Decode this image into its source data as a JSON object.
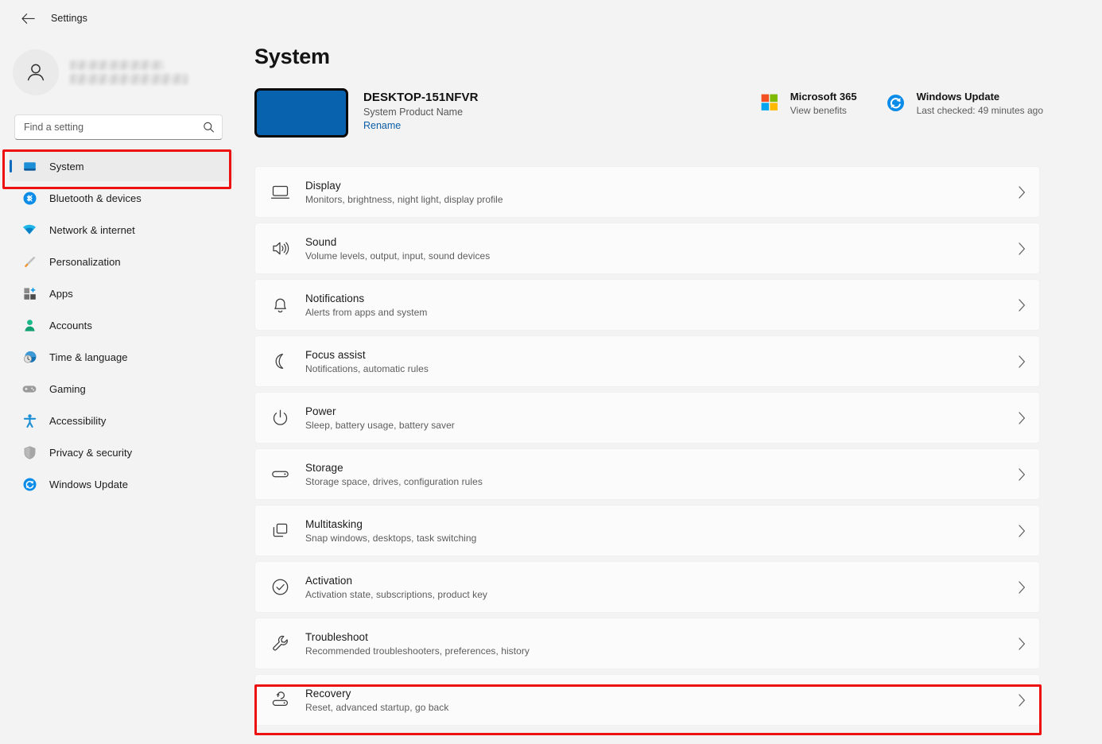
{
  "window": {
    "title": "Settings",
    "back_icon": "back-arrow-icon"
  },
  "sidebar": {
    "profile": {
      "name_redacted": true,
      "avatar_icon": "user-avatar-icon"
    },
    "search": {
      "placeholder": "Find a setting",
      "value": "",
      "icon": "search-icon"
    },
    "items": [
      {
        "label": "System",
        "icon": "system-monitor-icon",
        "selected": true
      },
      {
        "label": "Bluetooth & devices",
        "icon": "bluetooth-icon",
        "selected": false
      },
      {
        "label": "Network & internet",
        "icon": "wifi-icon",
        "selected": false
      },
      {
        "label": "Personalization",
        "icon": "paintbrush-icon",
        "selected": false
      },
      {
        "label": "Apps",
        "icon": "apps-grid-icon",
        "selected": false
      },
      {
        "label": "Accounts",
        "icon": "person-icon",
        "selected": false
      },
      {
        "label": "Time & language",
        "icon": "clock-globe-icon",
        "selected": false
      },
      {
        "label": "Gaming",
        "icon": "gamepad-icon",
        "selected": false
      },
      {
        "label": "Accessibility",
        "icon": "accessibility-person-icon",
        "selected": false
      },
      {
        "label": "Privacy & security",
        "icon": "shield-icon",
        "selected": false
      },
      {
        "label": "Windows Update",
        "icon": "update-refresh-icon",
        "selected": false
      }
    ]
  },
  "main": {
    "page_title": "System",
    "device": {
      "name": "DESKTOP-151NFVR",
      "product": "System Product Name",
      "rename_label": "Rename",
      "thumb_color": "#0862ad",
      "thumb_border": "#0a0a0a"
    },
    "quick_cards": [
      {
        "title": "Microsoft 365",
        "subtitle": "View benefits",
        "icon": "microsoft-logo-icon"
      },
      {
        "title": "Windows Update",
        "subtitle": "Last checked: 49 minutes ago",
        "icon": "update-refresh-icon"
      }
    ],
    "settings_rows": [
      {
        "title": "Display",
        "subtitle": "Monitors, brightness, night light, display profile",
        "icon": "monitor-icon",
        "highlighted": false
      },
      {
        "title": "Sound",
        "subtitle": "Volume levels, output, input, sound devices",
        "icon": "speaker-icon",
        "highlighted": false
      },
      {
        "title": "Notifications",
        "subtitle": "Alerts from apps and system",
        "icon": "bell-icon",
        "highlighted": false
      },
      {
        "title": "Focus assist",
        "subtitle": "Notifications, automatic rules",
        "icon": "moon-icon",
        "highlighted": false
      },
      {
        "title": "Power",
        "subtitle": "Sleep, battery usage, battery saver",
        "icon": "power-icon",
        "highlighted": false
      },
      {
        "title": "Storage",
        "subtitle": "Storage space, drives, configuration rules",
        "icon": "storage-drive-icon",
        "highlighted": false
      },
      {
        "title": "Multitasking",
        "subtitle": "Snap windows, desktops, task switching",
        "icon": "windows-stack-icon",
        "highlighted": false
      },
      {
        "title": "Activation",
        "subtitle": "Activation state, subscriptions, product key",
        "icon": "check-circle-icon",
        "highlighted": false
      },
      {
        "title": "Troubleshoot",
        "subtitle": "Recommended troubleshooters, preferences, history",
        "icon": "wrench-icon",
        "highlighted": false
      },
      {
        "title": "Recovery",
        "subtitle": "Reset, advanced startup, go back",
        "icon": "recovery-drive-icon",
        "highlighted": true
      }
    ],
    "chevron_icon": "chevron-right-icon"
  },
  "annotations": {
    "highlight_color": "#ee1111",
    "boxes": [
      {
        "target": "sidebar-item-system"
      },
      {
        "target": "settings-row-recovery"
      }
    ]
  }
}
